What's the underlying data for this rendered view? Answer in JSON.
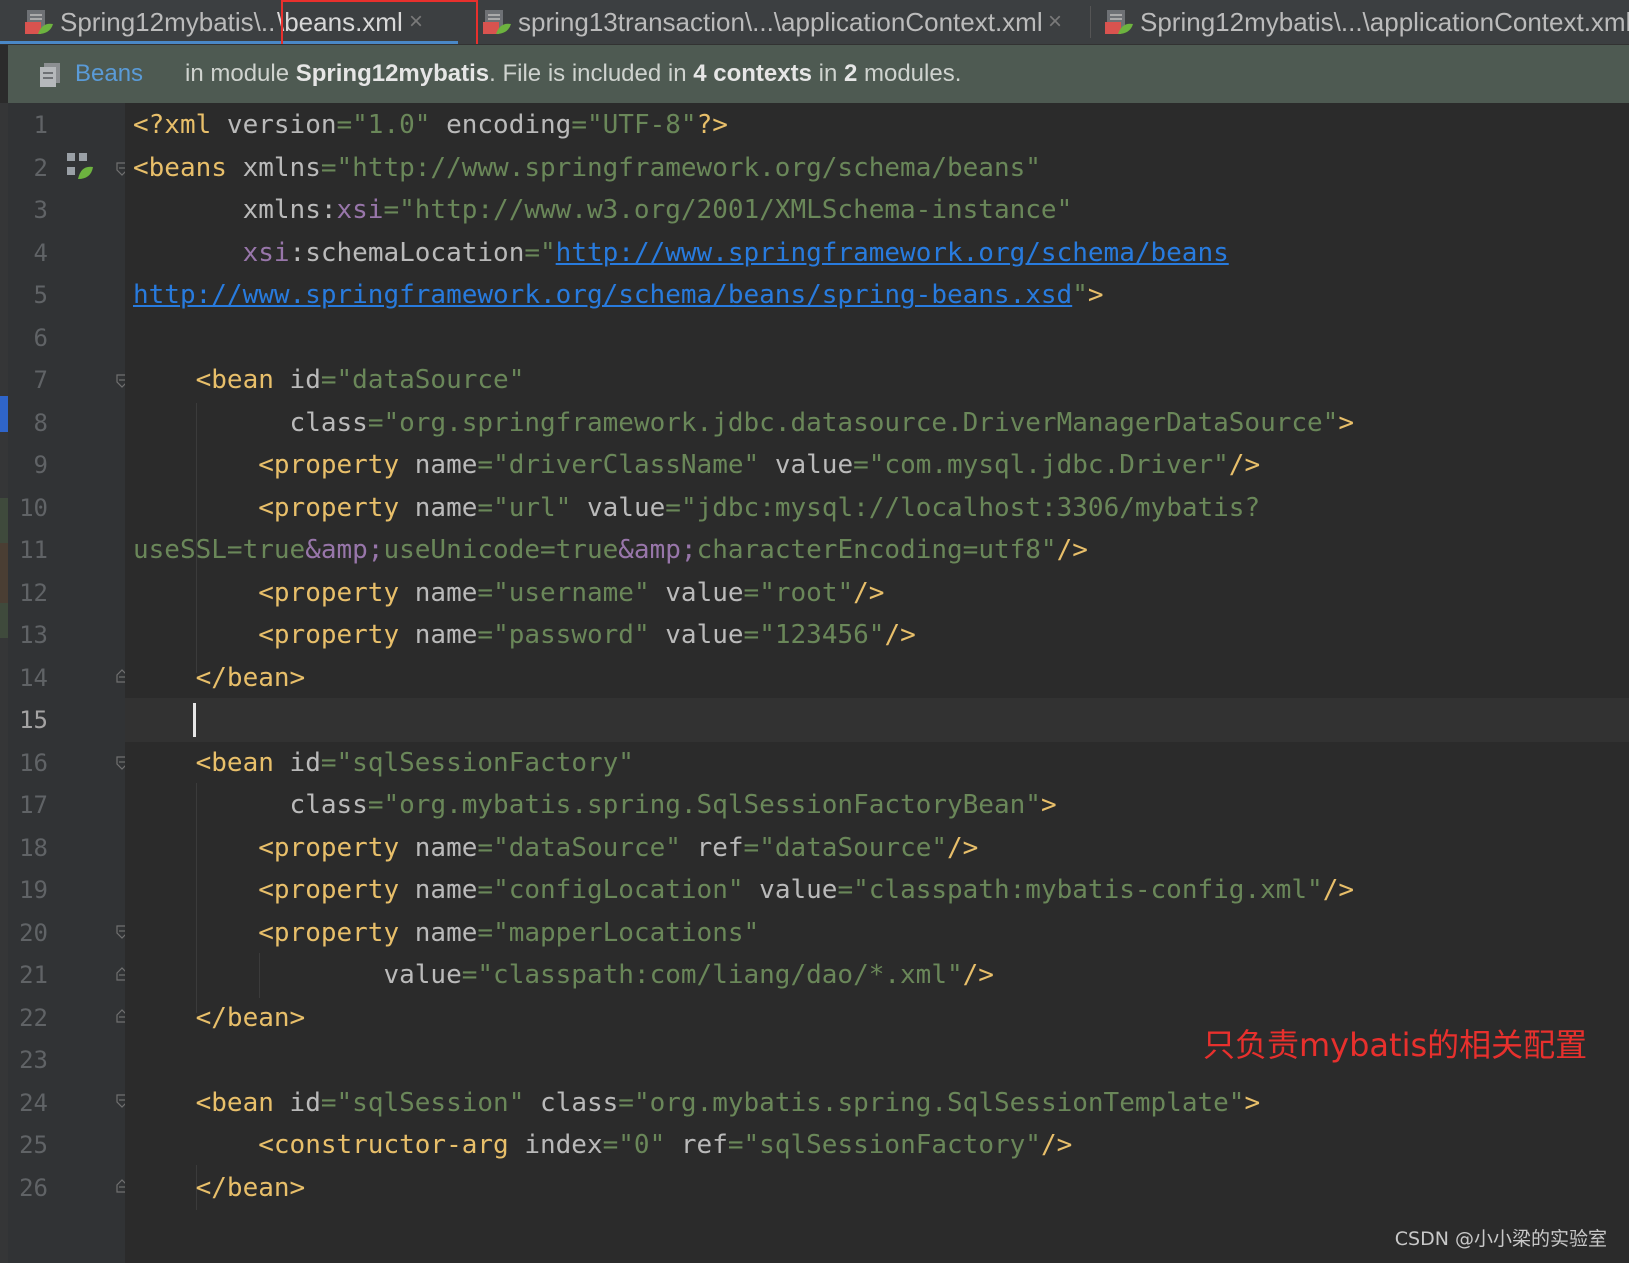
{
  "tabs": [
    {
      "label_prefix": "Spring12mybatis\\..",
      "label_main": "\\beans.xml",
      "icon": "spring-xml-icon",
      "close": "×",
      "active": true
    },
    {
      "label": "spring13transaction\\...\\applicationContext.xml",
      "icon": "spring-xml-icon",
      "close": "×",
      "active": false
    },
    {
      "label": "Spring12mybatis\\...\\applicationContext.xml",
      "icon": "spring-xml-icon",
      "active": false
    }
  ],
  "infobar": {
    "icon": "beans-icon",
    "link": "Beans",
    "text_1": "in module ",
    "module": "Spring12mybatis",
    "text_2": ". File is included in ",
    "contexts": "4 contexts",
    "text_3": " in ",
    "modules_count": "2",
    "text_4": " modules."
  },
  "editor": {
    "current_line": 15,
    "line_numbers": [
      "1",
      "2",
      "3",
      "4",
      "5",
      "6",
      "7",
      "8",
      "9",
      "10",
      "11",
      "12",
      "13",
      "14",
      "15",
      "16",
      "17",
      "18",
      "19",
      "20",
      "21",
      "22",
      "23",
      "24",
      "25",
      "26"
    ],
    "code": {
      "l1": {
        "t1": "<?xml ",
        "a1": "version",
        "e1": "=",
        "s1": "\"1.0\"",
        "sp": " ",
        "a2": "encoding",
        "e2": "=",
        "s2": "\"UTF-8\"",
        "t2": "?>"
      },
      "l2": {
        "t1": "<beans ",
        "a1": "xmlns",
        "e1": "=",
        "s1": "\"http://www.springframework.org/schema/beans\""
      },
      "l3": {
        "ind": "       ",
        "a1": "xmlns:",
        "p1": "xsi",
        "e1": "=",
        "s1": "\"http://www.w3.org/2001/XMLSchema-instance\""
      },
      "l4": {
        "ind": "       ",
        "p1": "xsi",
        "a1": ":schemaLocation",
        "e1": "=",
        "s1": "\"",
        "u1": "http://www.springframework.org/schema/beans"
      },
      "l5": {
        "u1": "http://www.springframework.org/schema/beans/spring-beans.xsd",
        "s1": "\"",
        "t1": ">"
      },
      "l7": {
        "ind": "    ",
        "t1": "<bean ",
        "a1": "id",
        "e1": "=",
        "s1": "\"dataSource\""
      },
      "l8": {
        "ind": "          ",
        "a1": "class",
        "e1": "=",
        "s1": "\"org.springframework.jdbc.datasource.DriverManagerDataSource\"",
        "t1": ">"
      },
      "l9": {
        "ind": "        ",
        "t1": "<property ",
        "a1": "name",
        "e1": "=",
        "s1": "\"driverClassName\"",
        "sp": " ",
        "a2": "value",
        "e2": "=",
        "s2": "\"com.mysql.jdbc.Driver\"",
        "t2": "/>"
      },
      "l10": {
        "ind": "        ",
        "t1": "<property ",
        "a1": "name",
        "e1": "=",
        "s1": "\"url\"",
        "sp": " ",
        "a2": "value",
        "e2": "=",
        "s2": "\"jdbc:mysql://localhost:3306/mybatis?"
      },
      "l11": {
        "s1": "useSSL=true",
        "s2": "&amp;",
        "s3": "useUnicode=true",
        "s4": "&amp;",
        "s5": "characterEncoding=utf8\"",
        "t1": "/>"
      },
      "l12": {
        "ind": "        ",
        "t1": "<property ",
        "a1": "name",
        "e1": "=",
        "s1": "\"username\"",
        "sp": " ",
        "a2": "value",
        "e2": "=",
        "s2": "\"root\"",
        "t2": "/>"
      },
      "l13": {
        "ind": "        ",
        "t1": "<property ",
        "a1": "name",
        "e1": "=",
        "s1": "\"password\"",
        "sp": " ",
        "a2": "value",
        "e2": "=",
        "s2": "\"123456\"",
        "t2": "/>"
      },
      "l14": {
        "ind": "    ",
        "t1": "</bean>"
      },
      "l16": {
        "ind": "    ",
        "t1": "<bean ",
        "a1": "id",
        "e1": "=",
        "s1": "\"sqlSessionFactory\""
      },
      "l17": {
        "ind": "          ",
        "a1": "class",
        "e1": "=",
        "s1": "\"org.mybatis.spring.SqlSessionFactoryBean\"",
        "t1": ">"
      },
      "l18": {
        "ind": "        ",
        "t1": "<property ",
        "a1": "name",
        "e1": "=",
        "s1": "\"dataSource\"",
        "sp": " ",
        "a2": "ref",
        "e2": "=",
        "s2": "\"dataSource\"",
        "t2": "/>"
      },
      "l19": {
        "ind": "        ",
        "t1": "<property ",
        "a1": "name",
        "e1": "=",
        "s1": "\"configLocation\"",
        "sp": " ",
        "a2": "value",
        "e2": "=",
        "s2": "\"classpath:mybatis-config.xml\"",
        "t2": "/>"
      },
      "l20": {
        "ind": "        ",
        "t1": "<property ",
        "a1": "name",
        "e1": "=",
        "s1": "\"mapperLocations\""
      },
      "l21": {
        "ind": "                ",
        "a1": "value",
        "e1": "=",
        "s1": "\"classpath:com/liang/dao/*.xml\"",
        "t1": "/>"
      },
      "l22": {
        "ind": "    ",
        "t1": "</bean>"
      },
      "l24": {
        "ind": "    ",
        "t1": "<bean ",
        "a1": "id",
        "e1": "=",
        "s1": "\"sqlSession\"",
        "sp": " ",
        "a2": "class",
        "e2": "=",
        "s2": "\"org.mybatis.spring.SqlSessionTemplate\"",
        "t2": ">"
      },
      "l25": {
        "ind": "        ",
        "t1": "<constructor-arg ",
        "a1": "index",
        "e1": "=",
        "s1": "\"0\"",
        "sp": " ",
        "a2": "ref",
        "e2": "=",
        "s2": "\"sqlSessionFactory\"",
        "t2": "/>"
      },
      "l26": {
        "ind": "    ",
        "t1": "</bean>"
      }
    }
  },
  "annotation": "只负责mybatis的相关配置",
  "watermark": "CSDN @小小梁的实验室",
  "colors": {
    "tag": "#e8bf6a",
    "attribute": "#bababa",
    "string": "#6a8759",
    "namespace": "#9876aa",
    "link": "#287bde",
    "annotation": "#e8302d",
    "active_tab_underline": "#4a88c7"
  }
}
